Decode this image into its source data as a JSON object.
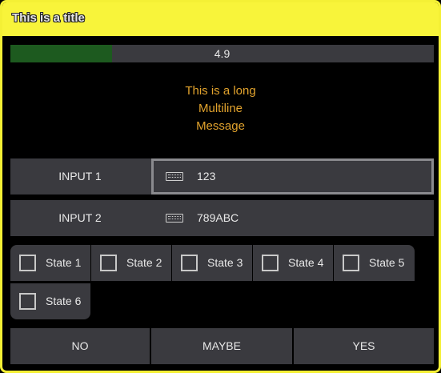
{
  "dialog": {
    "title": "This is a title"
  },
  "progress": {
    "value": 0.24,
    "label": "4.9"
  },
  "message": {
    "lines": [
      "This is a long",
      "Multiline",
      "Message"
    ]
  },
  "inputs": [
    {
      "label": "INPUT 1",
      "value": "123",
      "icon": "keyboard-icon",
      "focused": true
    },
    {
      "label": "INPUT 2",
      "value": "789ABC",
      "icon": "keyboard-icon",
      "focused": false
    }
  ],
  "states": [
    {
      "label": "State 1",
      "checked": false
    },
    {
      "label": "State 2",
      "checked": false
    },
    {
      "label": "State 3",
      "checked": false
    },
    {
      "label": "State 4",
      "checked": false
    },
    {
      "label": "State 5",
      "checked": false
    },
    {
      "label": "State 6",
      "checked": false
    }
  ],
  "buttons": {
    "no": "NO",
    "maybe": "MAYBE",
    "yes": "YES"
  },
  "colors": {
    "title_bar": "#f8f43a",
    "progress_fill": "#1d5a1f",
    "message_text": "#e2a32d",
    "panel": "#3a3a3f",
    "background": "#000000"
  }
}
